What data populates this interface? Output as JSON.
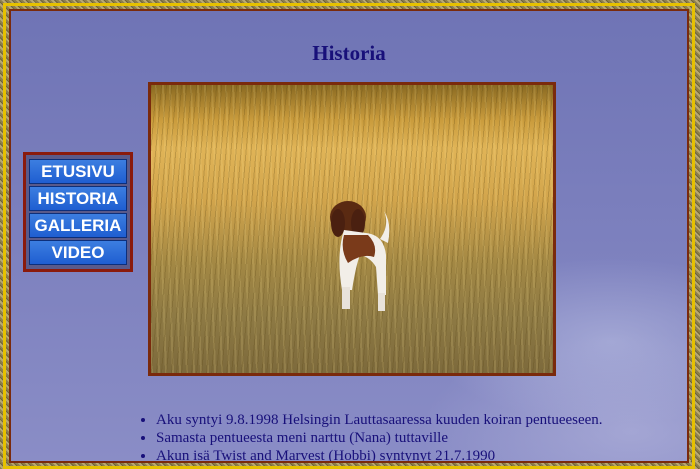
{
  "page": {
    "title": "Historia"
  },
  "nav": {
    "items": [
      {
        "label": "ETUSIVU"
      },
      {
        "label": "HISTORIA"
      },
      {
        "label": "GALLERIA"
      },
      {
        "label": "VIDEO"
      }
    ]
  },
  "photo": {
    "icon": "dog-in-field-photo"
  },
  "facts": [
    "Aku syntyi 9.8.1998 Helsingin Lauttasaaressa kuuden koiran pentueeseen.",
    "Samasta pentueesta meni narttu (Nana) tuttaville",
    "Akun isä Twist and Marvest (Hobbi) syntynyt 21.7.1990"
  ],
  "colors": {
    "title": "#18107a",
    "frame_gold": "#e6c100",
    "frame_brown": "#7a2a0c",
    "nav_button": "#1f5ed1"
  }
}
